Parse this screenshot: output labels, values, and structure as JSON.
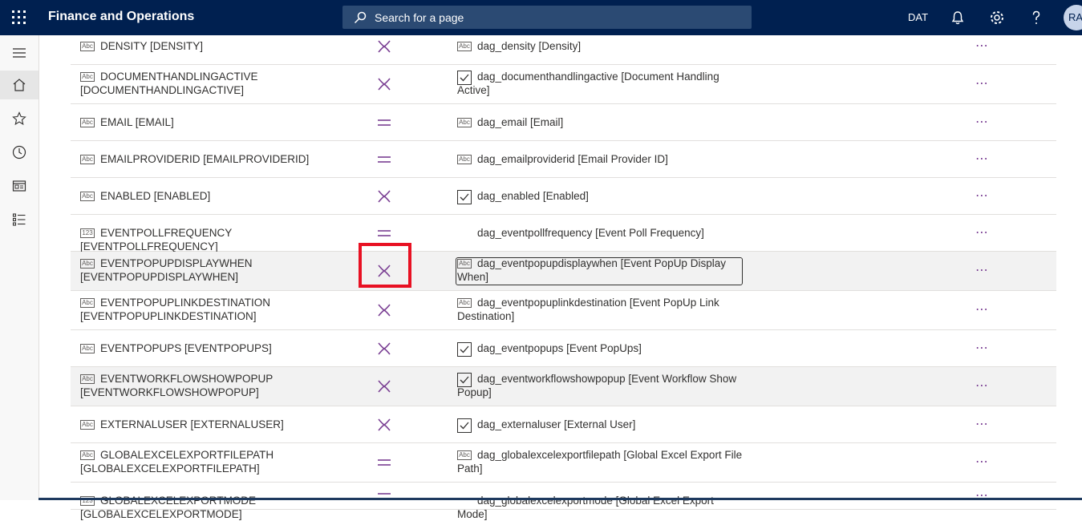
{
  "header": {
    "app_title": "Finance and Operations",
    "search_placeholder": "Search for a page",
    "company": "DAT",
    "avatar_initials": "RA"
  },
  "rail": {
    "items": [
      {
        "name": "menu-icon"
      },
      {
        "name": "home-icon"
      },
      {
        "name": "favorites-star-icon"
      },
      {
        "name": "recent-clock-icon"
      },
      {
        "name": "workspaces-icon"
      },
      {
        "name": "modules-list-icon"
      }
    ]
  },
  "rows": [
    {
      "src_type": "Abc",
      "src": "DENSITY [DENSITY]",
      "map": "diverge",
      "tgt_type": "Abc",
      "tgt": "dag_density [Density]"
    },
    {
      "src_type": "Abc",
      "src": "DOCUMENTHANDLINGACTIVE [DOCUMENTHANDLINGACTIVE]",
      "map": "diverge",
      "tgt_type": "check",
      "tgt": "dag_documenthandlingactive [Document Handling Active]"
    },
    {
      "src_type": "Abc",
      "src": "EMAIL [EMAIL]",
      "map": "equal",
      "tgt_type": "Abc",
      "tgt": "dag_email [Email]"
    },
    {
      "src_type": "Abc",
      "src": "EMAILPROVIDERID [EMAILPROVIDERID]",
      "map": "equal",
      "tgt_type": "Abc",
      "tgt": "dag_emailproviderid [Email Provider ID]"
    },
    {
      "src_type": "Abc",
      "src": "ENABLED [ENABLED]",
      "map": "diverge",
      "tgt_type": "check",
      "tgt": "dag_enabled [Enabled]"
    },
    {
      "src_type": "123",
      "src": "EVENTPOLLFREQUENCY [EVENTPOLLFREQUENCY]",
      "map": "equal",
      "tgt_type": "none",
      "tgt": "dag_eventpollfrequency [Event Poll Frequency]"
    },
    {
      "src_type": "Abc",
      "src": "EVENTPOPUPDISPLAYWHEN [EVENTPOPUPDISPLAYWHEN]",
      "map": "diverge",
      "tgt_type": "Abc",
      "tgt": "dag_eventpopupdisplaywhen [Event PopUp Display When]"
    },
    {
      "src_type": "Abc",
      "src": "EVENTPOPUPLINKDESTINATION [EVENTPOPUPLINKDESTINATION]",
      "map": "diverge",
      "tgt_type": "Abc",
      "tgt": "dag_eventpopuplinkdestination [Event PopUp Link Destination]"
    },
    {
      "src_type": "Abc",
      "src": "EVENTPOPUPS [EVENTPOPUPS]",
      "map": "diverge",
      "tgt_type": "check",
      "tgt": "dag_eventpopups [Event PopUps]"
    },
    {
      "src_type": "Abc",
      "src": "EVENTWORKFLOWSHOWPOPUP [EVENTWORKFLOWSHOWPOPUP]",
      "map": "diverge",
      "tgt_type": "check",
      "tgt": "dag_eventworkflowshowpopup [Event Workflow Show Popup]"
    },
    {
      "src_type": "Abc",
      "src": "EXTERNALUSER [EXTERNALUSER]",
      "map": "diverge",
      "tgt_type": "check",
      "tgt": "dag_externaluser [External User]"
    },
    {
      "src_type": "Abc",
      "src": "GLOBALEXCELEXPORTFILEPATH [GLOBALEXCELEXPORTFILEPATH]",
      "map": "equal",
      "tgt_type": "Abc",
      "tgt": "dag_globalexcelexportfilepath [Global Excel Export File Path]"
    },
    {
      "src_type": "123",
      "src": "GLOBALEXCELEXPORTMODE [GLOBALEXCELEXPORTMODE]",
      "map": "equal",
      "tgt_type": "none",
      "tgt": "dag_globalexcelexportmode [Global Excel Export Mode]"
    }
  ],
  "more_label": "⋯",
  "colors": {
    "accent": "#7a3f93",
    "header": "#002050",
    "highlight": "#e81123"
  }
}
